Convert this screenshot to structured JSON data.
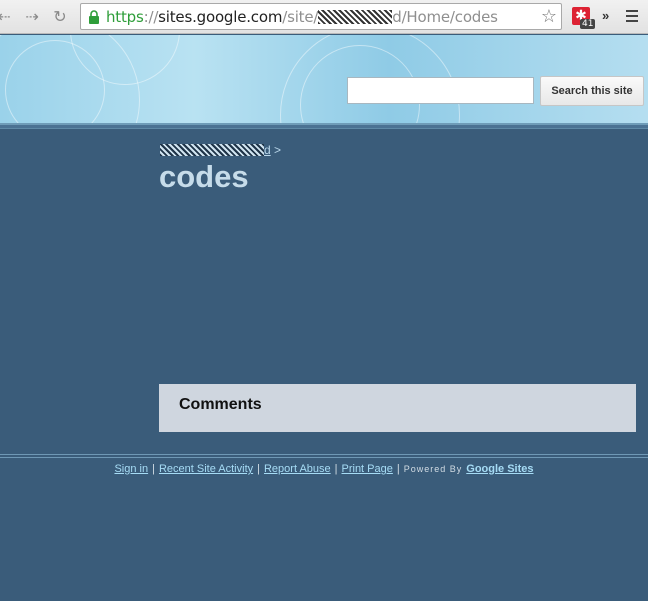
{
  "browser": {
    "url": {
      "scheme": "https",
      "separator": "://",
      "host": "sites.google.com",
      "path_start": "/site/",
      "path_end": "d/Home/codes"
    },
    "extension_badge": "41",
    "overflow_label": "»"
  },
  "search": {
    "value": "",
    "button_label": "Search this site"
  },
  "breadcrumb": {
    "last_char": "d",
    "separator": ">"
  },
  "page": {
    "title": "codes"
  },
  "comments": {
    "label": "Comments"
  },
  "footer": {
    "sign_in": "Sign in",
    "recent_activity": "Recent Site Activity",
    "report_abuse": "Report Abuse",
    "print_page": "Print Page",
    "separator": "|",
    "powered_by": "Powered By",
    "google_sites": "Google Sites"
  },
  "colors": {
    "page_bg": "#3a5c7a",
    "header_bg": "#9ad2ea",
    "comments_bg": "#cfd6df",
    "link": "#a6dcf5"
  }
}
